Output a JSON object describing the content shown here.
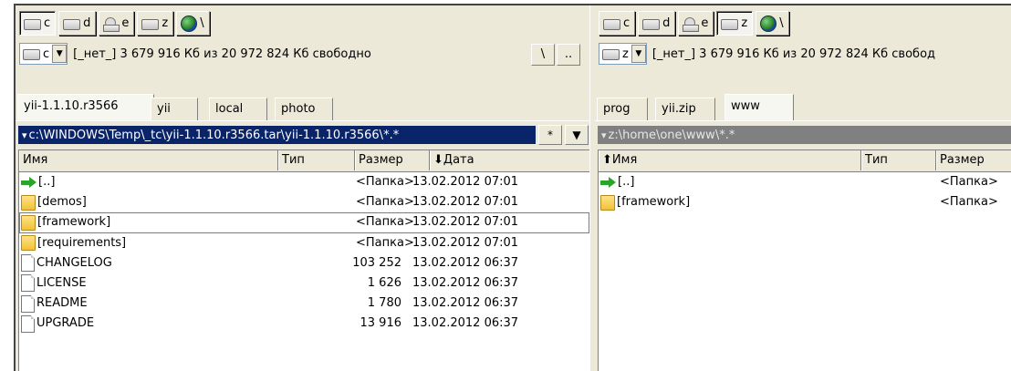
{
  "left": {
    "drives": [
      {
        "letter": "c",
        "type": "hdd",
        "active": true
      },
      {
        "letter": "d",
        "type": "hdd",
        "active": false
      },
      {
        "letter": "e",
        "type": "cd",
        "active": false
      },
      {
        "letter": "z",
        "type": "hdd",
        "active": false
      },
      {
        "letter": "\\",
        "type": "net",
        "active": false
      }
    ],
    "drive_select": "c",
    "free_info": "[_нет_]  3 679 916 Кб из 20 972 824 Кб свободно",
    "root_button": "\\",
    "up_button": "..",
    "tabs": [
      "yii-1.1.10.r3566",
      "yii",
      "local",
      "photo"
    ],
    "active_tab": 0,
    "path": "c:\\WINDOWS\\Temp\\_tc\\yii-1.1.10.r3566.tar\\yii-1.1.10.r3566\\*.*",
    "filter_button": "*",
    "history_button": "▼",
    "columns": {
      "name": "Имя",
      "type": "Тип",
      "size": "Размер",
      "date": "Дата"
    },
    "rows": [
      {
        "icon": "up-arrow-icon",
        "name": "[..]",
        "size": "<Папка>",
        "date": "13.02.2012 07:01"
      },
      {
        "icon": "folder-icon",
        "name": "[demos]",
        "size": "<Папка>",
        "date": "13.02.2012 07:01"
      },
      {
        "icon": "folder-icon",
        "name": "[framework]",
        "size": "<Папка>",
        "date": "13.02.2012 07:01"
      },
      {
        "icon": "folder-icon",
        "name": "[requirements]",
        "size": "<Папка>",
        "date": "13.02.2012 07:01"
      },
      {
        "icon": "file-icon",
        "name": "CHANGELOG",
        "size": "103 252",
        "date": "13.02.2012 06:37"
      },
      {
        "icon": "file-icon",
        "name": "LICENSE",
        "size": "1 626",
        "date": "13.02.2012 06:37"
      },
      {
        "icon": "file-icon",
        "name": "README",
        "size": "1 780",
        "date": "13.02.2012 06:37"
      },
      {
        "icon": "file-icon",
        "name": "UPGRADE",
        "size": "13 916",
        "date": "13.02.2012 06:37"
      }
    ]
  },
  "right": {
    "drives": [
      {
        "letter": "c",
        "type": "hdd",
        "active": false
      },
      {
        "letter": "d",
        "type": "hdd",
        "active": false
      },
      {
        "letter": "e",
        "type": "cd",
        "active": false
      },
      {
        "letter": "z",
        "type": "hdd",
        "active": true
      },
      {
        "letter": "\\",
        "type": "net",
        "active": false
      }
    ],
    "drive_select": "z",
    "free_info": "[_нет_]  3 679 916 Кб из 20 972 824 Кб свобод",
    "tabs": [
      "prog",
      "yii.zip",
      "www"
    ],
    "active_tab": 2,
    "path": "z:\\home\\one\\www\\*.*",
    "columns": {
      "name": "Имя",
      "type": "Тип",
      "size": "Размер"
    },
    "rows": [
      {
        "icon": "up-arrow-icon",
        "name": "[..]",
        "size": "<Папка>"
      },
      {
        "icon": "folder-icon",
        "name": "[framework]",
        "size": "<Папка>"
      }
    ]
  }
}
